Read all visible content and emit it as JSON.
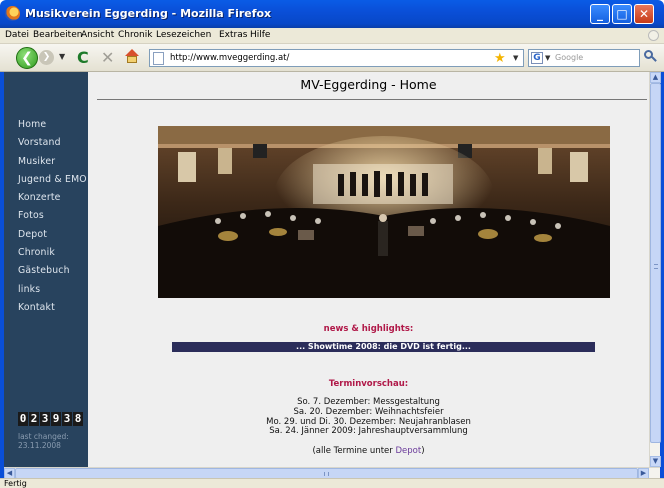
{
  "window": {
    "title": "Musikverein Eggerding - Mozilla Firefox",
    "buttons": {
      "minimize": "_",
      "maximize": "□",
      "close": "✕"
    }
  },
  "menu": [
    "Datei",
    "Bearbeiten",
    "Ansicht",
    "Chronik",
    "Lesezeichen",
    "Extras",
    "Hilfe"
  ],
  "toolbar": {
    "url": "http://www.mveggerding.at/",
    "search_placeholder": "Google",
    "icons": [
      "back-arrow-icon",
      "forward-arrow-icon",
      "reload-icon",
      "stop-icon",
      "home-icon",
      "bookmark-star-icon",
      "search-icon"
    ],
    "glyphs": {
      "back": "❮",
      "forward": "❯",
      "dropdown": "▼",
      "reload": "C",
      "stop": "✕",
      "star": "★",
      "search_engine": "G"
    }
  },
  "sidebar": {
    "items": [
      "Home",
      "Vorstand",
      "Musiker",
      "Jugend & EMO",
      "Konzerte",
      "Fotos",
      "Depot",
      "Chronik",
      "Gästebuch",
      "links",
      "Kontakt"
    ],
    "counter": [
      "0",
      "2",
      "3",
      "9",
      "3",
      "8"
    ],
    "last_changed_label": "last changed:",
    "last_changed_date": "23.11.2008"
  },
  "page": {
    "title": "MV-Eggerding - Home",
    "news_heading": "news & highlights:",
    "news_item": "... Showtime 2008: die DVD ist fertig...",
    "termin_heading": "Terminvorschau:",
    "events": [
      "So. 7. Dezember: Messgestaltung",
      "Sa. 20. Dezember: Weihnachtsfeier",
      "Mo. 29. und Di. 30. Dezember: Neujahranblasen",
      "Sa. 24. Jänner 2009: Jahreshauptversammlung"
    ],
    "all_events_prefix": "(alle Termine unter ",
    "all_events_link": "Depot",
    "all_events_suffix": ")"
  },
  "scrollbars": {
    "up": "▲",
    "down": "▼",
    "left": "◀",
    "right": "▶"
  },
  "status": "Fertig",
  "colors": {
    "sidebar": "#28435e",
    "accent": "#b01848",
    "news_bar": "#2b2d5a",
    "titlebar": "#0a4fd8"
  }
}
